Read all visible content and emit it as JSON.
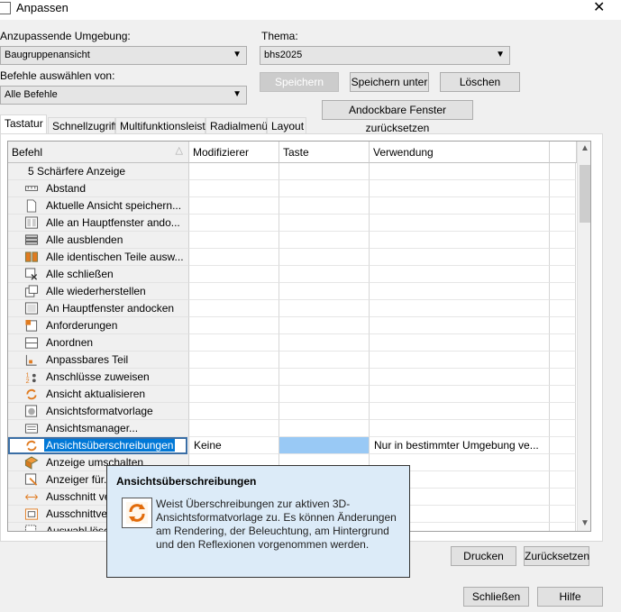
{
  "window": {
    "title": "Anpassen",
    "close_glyph": "✕"
  },
  "form": {
    "env_label": "Anzupassende Umgebung:",
    "env_value": "Baugruppenansicht",
    "theme_label": "Thema:",
    "theme_value": "bhs2025",
    "cmd_from_label": "Befehle auswählen von:",
    "cmd_from_value": "Alle Befehle"
  },
  "buttons": {
    "save": "Speichern",
    "save_as": "Speichern unter",
    "delete": "Löschen",
    "reset_dock": "Andockbare Fenster zurücksetzen",
    "print": "Drucken",
    "reset": "Zurücksetzen",
    "close": "Schließen",
    "help": "Hilfe"
  },
  "tabs": [
    "Tastatur",
    "Schnellzugriff",
    "Multifunktionsleiste",
    "Radialmenü",
    "Layout"
  ],
  "columns": [
    "Befehl",
    "Modifizierer",
    "Taste",
    "Verwendung"
  ],
  "rows": [
    {
      "name": "5 Schärfere Anzeige",
      "icon": "none"
    },
    {
      "name": "Abstand",
      "icon": "ruler-icon"
    },
    {
      "name": "Aktuelle Ansicht speichern...",
      "icon": "document-icon"
    },
    {
      "name": "Alle an Hauptfenster ando...",
      "icon": "dock-all-icon"
    },
    {
      "name": "Alle ausblenden",
      "icon": "hide-all-icon"
    },
    {
      "name": "Alle identischen Teile ausw...",
      "icon": "identical-parts-icon"
    },
    {
      "name": "Alle schließen",
      "icon": "close-all-icon"
    },
    {
      "name": "Alle wiederherstellen",
      "icon": "restore-all-icon"
    },
    {
      "name": "An Hauptfenster andocken",
      "icon": "dock-icon"
    },
    {
      "name": "Anforderungen",
      "icon": "requirements-icon"
    },
    {
      "name": "Anordnen",
      "icon": "arrange-icon"
    },
    {
      "name": "Anpassbares Teil",
      "icon": "adaptable-part-icon"
    },
    {
      "name": "Anschlüsse zuweisen",
      "icon": "assign-connections-icon"
    },
    {
      "name": "Ansicht aktualisieren",
      "icon": "refresh-view-icon"
    },
    {
      "name": "Ansichtsformatvorlage",
      "icon": "view-style-icon"
    },
    {
      "name": "Ansichtsmanager...",
      "icon": "view-manager-icon"
    },
    {
      "name": "Ansichtsüberschreibungen",
      "icon": "view-override-icon",
      "modifier": "Keine",
      "key": "",
      "usage": "Nur in bestimmter Umgebung ve...",
      "selected": true
    },
    {
      "name": "Anzeige umschalten",
      "icon": "toggle-display-icon"
    },
    {
      "name": "Anzeiger für...",
      "icon": "indicator-icon"
    },
    {
      "name": "Ausschnitt ve...",
      "icon": "section-icon"
    },
    {
      "name": "Ausschnittve...",
      "icon": "section-view-icon"
    },
    {
      "name": "Auswahl lösc...",
      "icon": "clear-selection-icon"
    }
  ],
  "tooltip": {
    "title": "Ansichtsüberschreibungen",
    "body": "Weist Überschreibungen zur aktiven 3D-Ansichtsformatvorlage zu. Es können Änderungen am Rendering, der Beleuchtung, am Hintergrund und den Reflexionen vorgenommen werden."
  }
}
